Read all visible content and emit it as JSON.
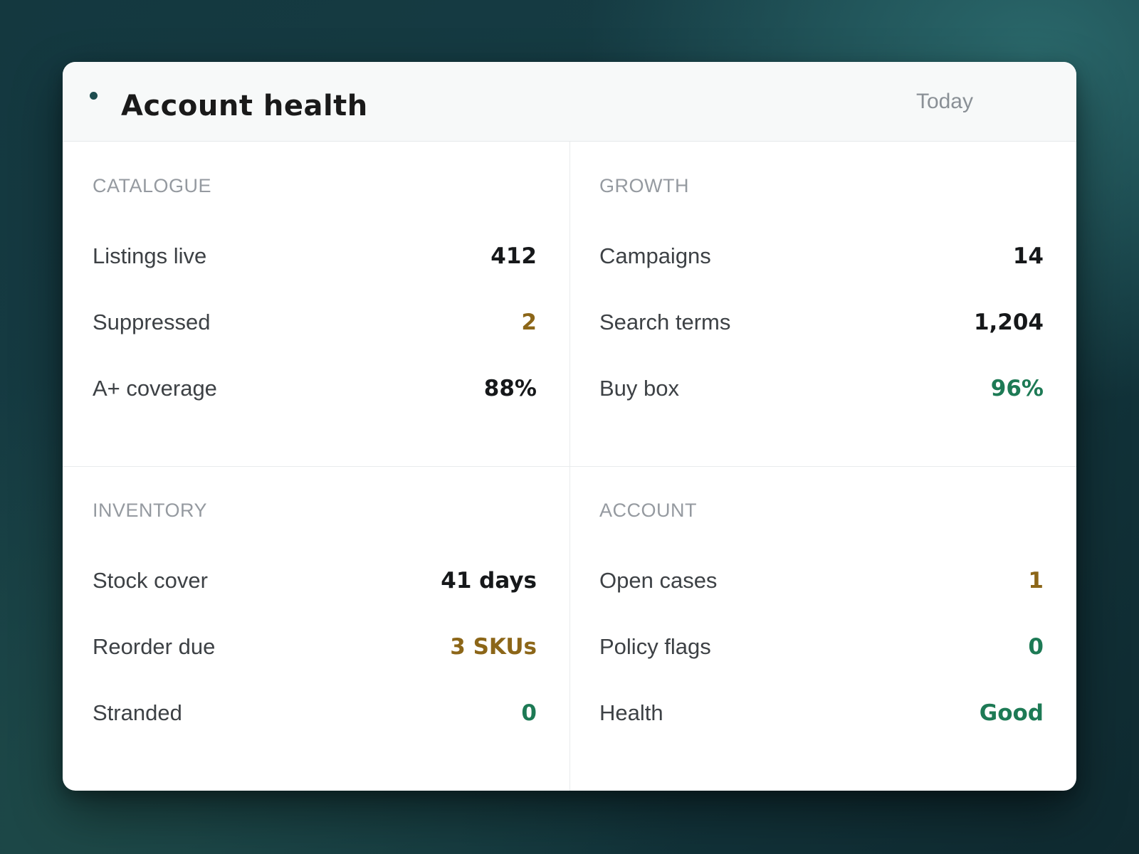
{
  "header": {
    "title": "Account health",
    "period": "Today"
  },
  "colors": {
    "neutral": "#16181a",
    "warning": "#8c6618",
    "good": "#1d7a55",
    "section_title": "#959aa0"
  },
  "sections": [
    {
      "title": "CATALOGUE",
      "rows": [
        {
          "label": "Listings live",
          "value": "412",
          "status": "neutral"
        },
        {
          "label": "Suppressed",
          "value": "2",
          "status": "warning"
        },
        {
          "label": "A+ coverage",
          "value": "88%",
          "status": "neutral"
        }
      ]
    },
    {
      "title": "GROWTH",
      "rows": [
        {
          "label": "Campaigns",
          "value": "14",
          "status": "neutral"
        },
        {
          "label": "Search terms",
          "value": "1,204",
          "status": "neutral"
        },
        {
          "label": "Buy box",
          "value": "96%",
          "status": "good"
        }
      ]
    },
    {
      "title": "INVENTORY",
      "rows": [
        {
          "label": "Stock cover",
          "value": "41 days",
          "status": "neutral"
        },
        {
          "label": "Reorder due",
          "value": "3 SKUs",
          "status": "warning"
        },
        {
          "label": "Stranded",
          "value": "0",
          "status": "good"
        }
      ]
    },
    {
      "title": "ACCOUNT",
      "rows": [
        {
          "label": "Open cases",
          "value": "1",
          "status": "warning"
        },
        {
          "label": "Policy flags",
          "value": "0",
          "status": "good"
        },
        {
          "label": "Health",
          "value": "Good",
          "status": "good"
        }
      ]
    }
  ]
}
